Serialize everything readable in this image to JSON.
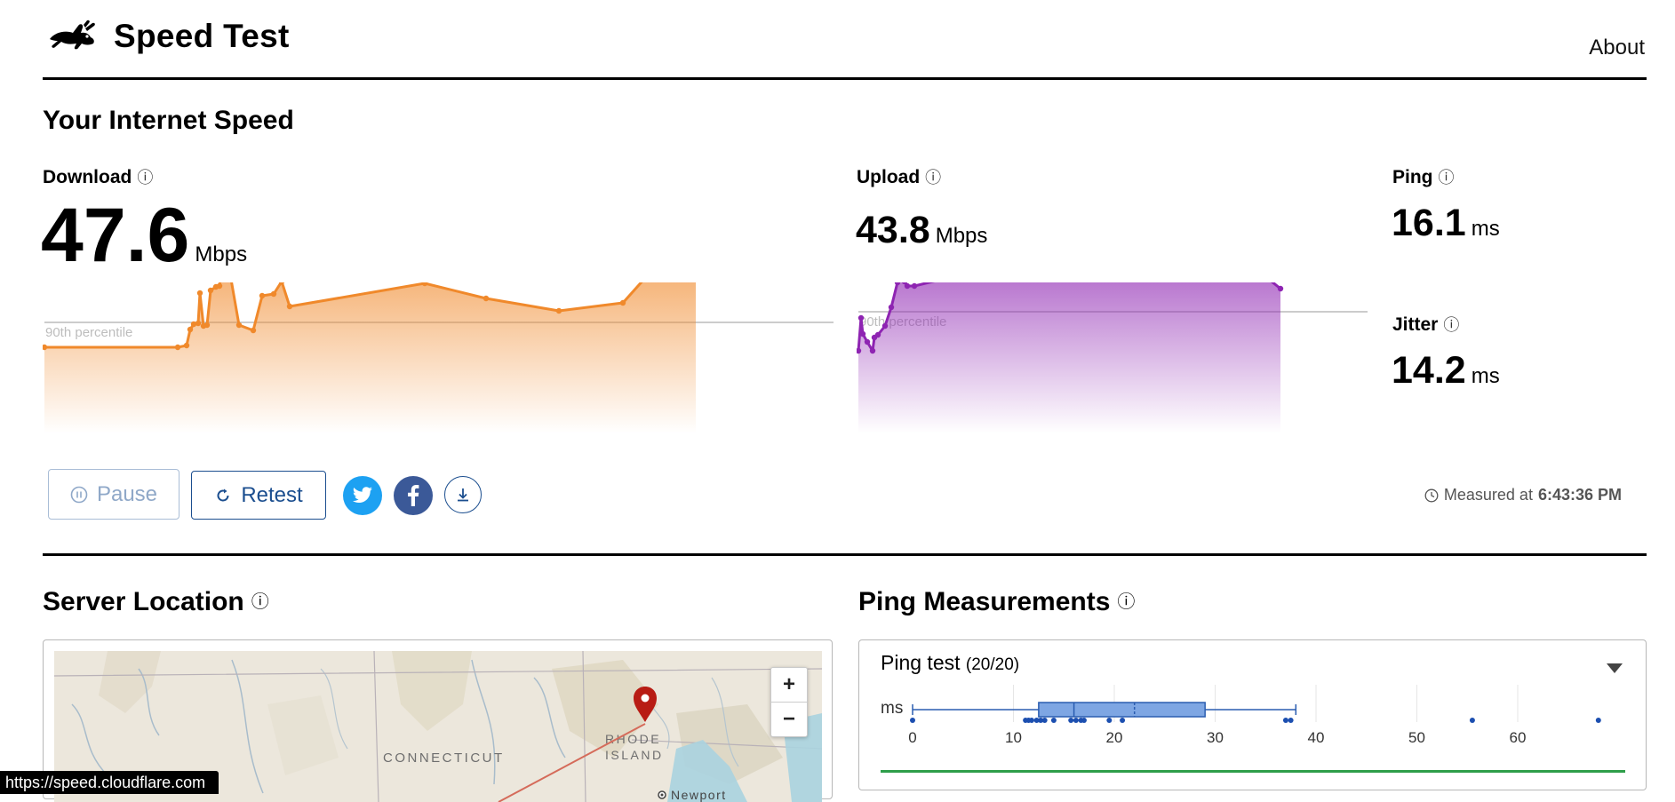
{
  "header": {
    "title": "Speed Test",
    "about": "About"
  },
  "section_speed": {
    "title": "Your Internet Speed",
    "info": "ⓘ"
  },
  "download": {
    "label": "Download",
    "info": "ⓘ",
    "value": "47.6",
    "unit": "Mbps",
    "percentile_label": "90th percentile",
    "color": "#f0892b"
  },
  "upload": {
    "label": "Upload",
    "info": "ⓘ",
    "value": "43.8",
    "unit": "Mbps",
    "percentile_label": "90th percentile",
    "color": "#8e24b2"
  },
  "ping": {
    "label": "Ping",
    "info": "ⓘ",
    "value": "16.1",
    "unit": "ms"
  },
  "jitter": {
    "label": "Jitter",
    "info": "ⓘ",
    "value": "14.2",
    "unit": "ms"
  },
  "actions": {
    "pause": "Pause",
    "retest": "Retest"
  },
  "measured": {
    "prefix": "Measured at",
    "time": "6:43:36 PM"
  },
  "server_location": {
    "title": "Server Location",
    "info": "ⓘ",
    "labels": {
      "state1": "CONNECTICUT",
      "state2": "RHODE",
      "state3": "ISLAND",
      "city": "Newport"
    },
    "zoom_in": "+",
    "zoom_out": "−"
  },
  "ping_measurements": {
    "title": "Ping Measurements",
    "info": "ⓘ",
    "test_label": "Ping test",
    "test_count": "(20/20)",
    "axis_unit": "ms",
    "chart_data": {
      "type": "box",
      "xlim": [
        0,
        65
      ],
      "ticks": [
        0,
        10,
        20,
        30,
        40,
        50,
        60
      ],
      "box": {
        "min": 0,
        "q1": 12.5,
        "median": 16,
        "mean": 22,
        "q3": 29,
        "max": 38
      },
      "points": [
        0,
        11.2,
        11.5,
        11.8,
        12.3,
        12.7,
        13.1,
        14,
        15.7,
        16.2,
        16.7,
        17,
        19.5,
        20.8,
        37,
        37.5,
        55.5,
        68
      ]
    }
  },
  "status_url": "https://speed.cloudflare.com",
  "download_chart": {
    "points": [
      [
        0,
        391
      ],
      [
        150,
        391
      ],
      [
        160,
        389
      ],
      [
        164,
        371
      ],
      [
        168,
        365
      ],
      [
        173,
        364
      ],
      [
        175,
        330
      ],
      [
        179,
        367
      ],
      [
        183,
        366
      ],
      [
        187,
        327
      ],
      [
        193,
        323
      ],
      [
        197,
        322
      ],
      [
        203,
        281
      ],
      [
        208,
        303
      ],
      [
        219,
        366
      ],
      [
        235,
        372
      ],
      [
        245,
        333
      ],
      [
        258,
        331
      ],
      [
        267,
        317
      ],
      [
        276,
        345
      ],
      [
        428,
        319
      ],
      [
        497,
        336
      ],
      [
        579,
        350
      ],
      [
        651,
        341
      ],
      [
        693,
        294
      ],
      [
        733,
        283
      ]
    ]
  },
  "upload_chart": {
    "points": [
      [
        0,
        395
      ],
      [
        3,
        358
      ],
      [
        5,
        376
      ],
      [
        10,
        385
      ],
      [
        16,
        395
      ],
      [
        18,
        380
      ],
      [
        22,
        377
      ],
      [
        30,
        367
      ],
      [
        37,
        346
      ],
      [
        44,
        318
      ],
      [
        48,
        309
      ],
      [
        52,
        317
      ],
      [
        55,
        322
      ],
      [
        63,
        322
      ],
      [
        205,
        288
      ],
      [
        345,
        281
      ],
      [
        388,
        295
      ],
      [
        422,
        282
      ],
      [
        475,
        325
      ]
    ]
  }
}
